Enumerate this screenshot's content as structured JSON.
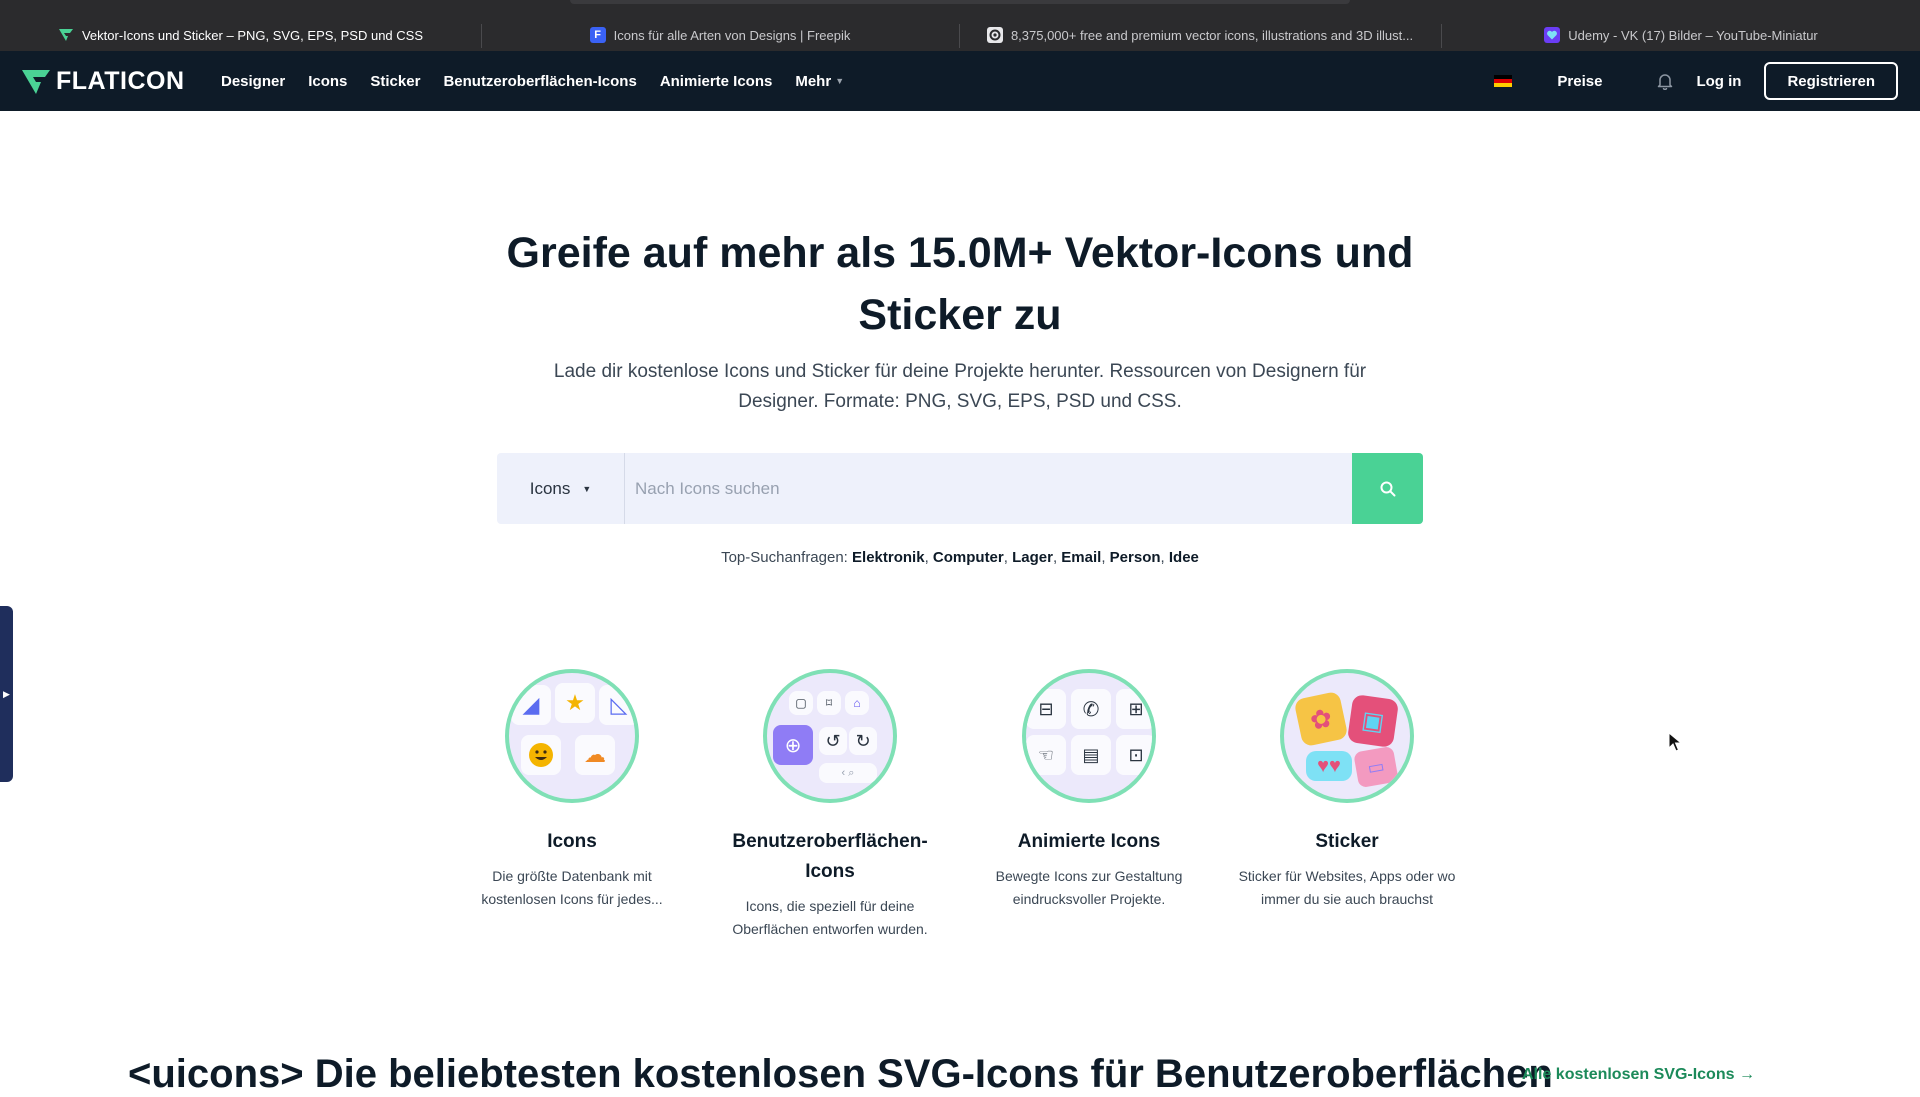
{
  "browser": {
    "tabs": [
      {
        "title": "Vektor-Icons und Sticker – PNG, SVG, EPS, PSD und CSS",
        "favicon": "flaticon-icon",
        "active": true
      },
      {
        "title": "Icons für alle Arten von Designs | Freepik",
        "favicon": "freepik-icon",
        "active": false
      },
      {
        "title": "8,375,000+ free and premium vector icons, illustrations and 3D illust...",
        "favicon": "iconscout-icon",
        "active": false
      },
      {
        "title": "Udemy - VK (17) Bilder – YouTube-Miniatur",
        "favicon": "heart-icon",
        "active": false
      }
    ]
  },
  "header": {
    "logo": "FLATICON",
    "nav": [
      "Designer",
      "Icons",
      "Sticker",
      "Benutzeroberflächen-Icons",
      "Animierte Icons",
      "Mehr"
    ],
    "pricing": "Preise",
    "login": "Log in",
    "register": "Registrieren"
  },
  "hero": {
    "title": "Greife auf mehr als 15.0M+ Vektor-Icons und Sticker zu",
    "subtitle": "Lade dir kostenlose Icons und Sticker für deine Projekte herunter. Ressourcen von Designern für Designer. Formate: PNG, SVG, EPS, PSD und CSS.",
    "search": {
      "type": "Icons",
      "placeholder": "Nach Icons suchen"
    },
    "top_searches_label": "Top-Suchanfragen:",
    "top_searches": [
      "Elektronik",
      "Computer",
      "Lager",
      "Email",
      "Person",
      "Idee"
    ]
  },
  "categories": [
    {
      "title": "Icons",
      "desc": "Die größte Datenbank mit kostenlosen Icons für jedes..."
    },
    {
      "title": "Benutzeroberflächen-Icons",
      "desc": "Icons, die speziell für deine Oberflächen entworfen wurden."
    },
    {
      "title": "Animierte Icons",
      "desc": "Bewegte Icons zur Gestaltung eindrucksvoller Projekte."
    },
    {
      "title": "Sticker",
      "desc": "Sticker für Websites, Apps oder wo immer du sie auch brauchst"
    }
  ],
  "bottom": {
    "title": "<uicons> Die beliebtesten kostenlosen SVG-Icons für Benutzeroberflächen",
    "link": "Alle kostenlosen SVG-Icons →"
  },
  "colors": {
    "header_bg": "#0e1b28",
    "accent_green": "#4ad295",
    "search_bg": "#eef1fb"
  }
}
